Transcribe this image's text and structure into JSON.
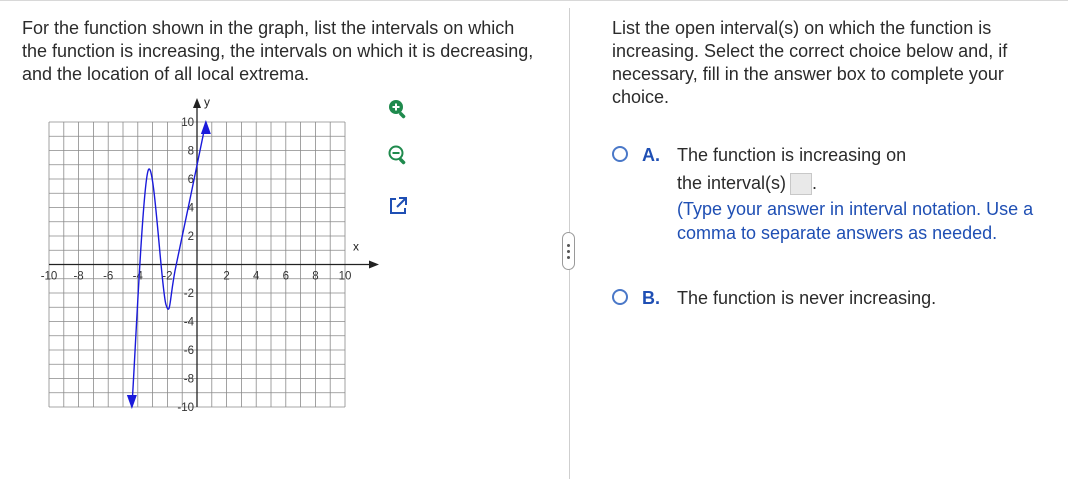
{
  "question": {
    "text": "For the function shown in the graph, list the intervals on which the function is increasing, the intervals on which it is decreasing, and the location of all local extrema."
  },
  "graph": {
    "x_axis_label": "x",
    "y_axis_label": "y",
    "x_tick_labels": [
      "-10",
      "-8",
      "-6",
      "-4",
      "-2",
      "2",
      "4",
      "6",
      "8",
      "10"
    ],
    "y_tick_labels": [
      "10",
      "8",
      "6",
      "4",
      "2",
      "-2",
      "-4",
      "-6",
      "-8",
      "-10"
    ],
    "xlim": [
      -10,
      10
    ],
    "ylim": [
      -10,
      10
    ],
    "curve_color": "#1a1adb",
    "arrow_color": "#1a1adb",
    "curve_points": [
      [
        -4.4,
        -10
      ],
      [
        -3.3,
        6.6
      ],
      [
        -2.1,
        -2.8
      ],
      [
        -1.4,
        0
      ],
      [
        0.6,
        10
      ]
    ]
  },
  "tools": [
    {
      "name": "zoom-in",
      "icon": "zoom-in-icon"
    },
    {
      "name": "zoom-out",
      "icon": "zoom-out-icon"
    },
    {
      "name": "open-popout",
      "icon": "popout-icon"
    }
  ],
  "instruction": {
    "text": "List the open interval(s) on which the function is increasing. Select the correct choice below and, if necessary, fill in the answer box to complete your choice."
  },
  "choices": [
    {
      "letter": "A.",
      "line1": "The function is increasing on",
      "line2": "the interval(s)",
      "line2_suffix": ".",
      "hint": "(Type your answer in interval notation. Use a comma to separate answers as needed."
    },
    {
      "letter": "B.",
      "line1": "The function is never increasing."
    }
  ],
  "colors": {
    "accent": "#1f4fb4",
    "radio_border": "#4a78c8",
    "icon_green": "#1f8a4d",
    "icon_blue_pop": "#1f4fb4"
  }
}
